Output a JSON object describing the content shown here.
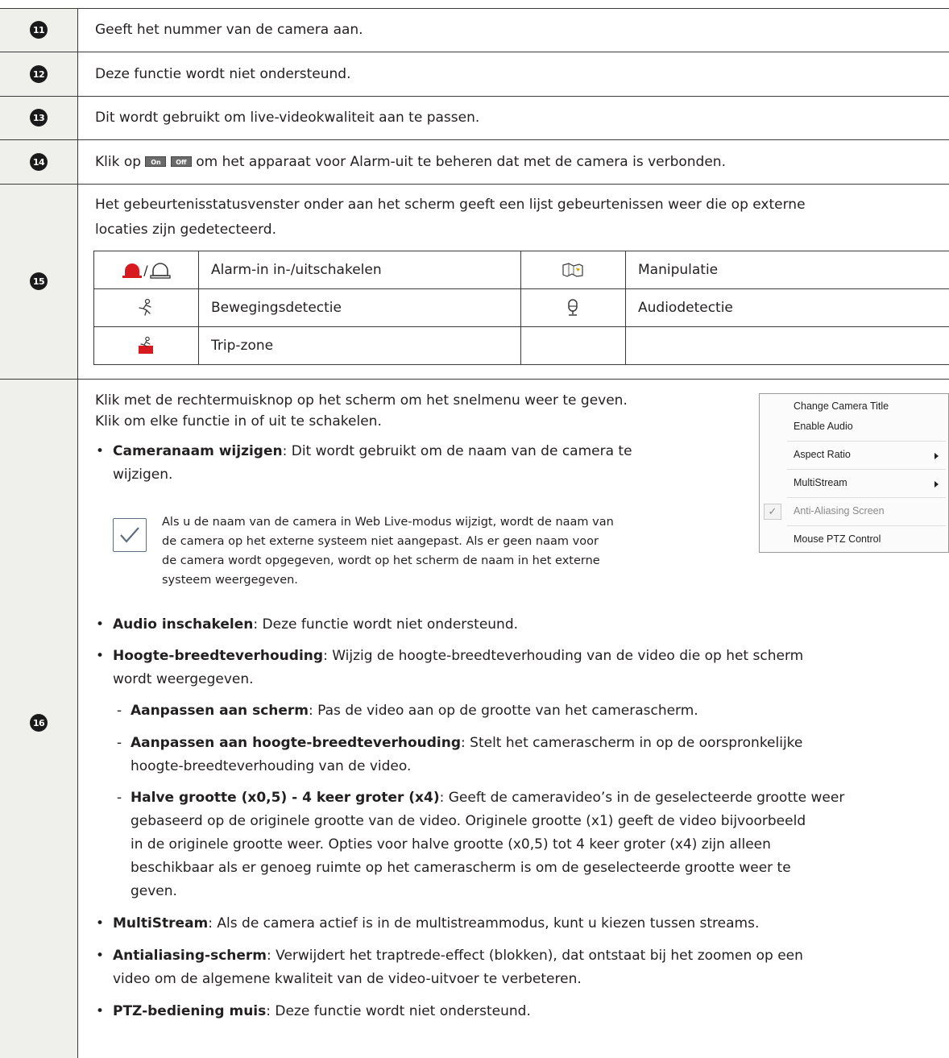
{
  "rows": [
    {
      "num": "11",
      "text": "Geeft het nummer van de camera aan."
    },
    {
      "num": "12",
      "text": "Deze functie wordt niet ondersteund."
    },
    {
      "num": "13",
      "text": "Dit wordt gebruikt om live-videokwaliteit aan te passen."
    },
    {
      "num": "14",
      "text_before": "Klik op",
      "btn_on": "On",
      "btn_off": "Off",
      "text_after": "om het apparaat voor Alarm-uit te beheren dat met de camera is verbonden."
    },
    {
      "num": "15",
      "line1": "Het gebeurtenisstatusvenster onder aan het scherm geeft een lijst gebeurtenissen weer die op externe",
      "line2": "locaties zijn gedetecteerd."
    },
    {
      "num": "16"
    }
  ],
  "events": [
    {
      "icon": "alarm-in-icon",
      "sep": "/",
      "label": "Alarm-in in-/uitschakelen"
    },
    {
      "icon": "tampering-icon",
      "label": "Manipulatie"
    },
    {
      "icon": "motion-detection-icon",
      "label": "Bewegingsdetectie"
    },
    {
      "icon": "audio-detection-icon",
      "label": "Audiodetectie"
    },
    {
      "icon": "trip-zone-icon",
      "label": "Trip-zone"
    }
  ],
  "row16": {
    "intro1": "Klik met de rechtermuisknop op het scherm om het snelmenu weer te geven.",
    "intro2": "Klik om elke functie in of uit te schakelen.",
    "cam_title": "Cameranaam wijzigen",
    "cam_desc1": ": Dit wordt gebruikt om de naam van de camera te",
    "cam_desc2": "wijzigen.",
    "note": [
      "Als u de naam van de camera in Web Live-modus wijzigt, wordt de naam van",
      "de camera op het externe systeem niet aangepast. Als er geen naam voor",
      "de camera wordt opgegeven, wordt op het scherm de naam in het externe",
      "systeem weergegeven."
    ],
    "audio_title": "Audio inschakelen",
    "audio_desc": ": Deze functie wordt niet ondersteund.",
    "aspect_title": "Hoogte-breedteverhouding",
    "aspect_desc1": ": Wijzig de hoogte-breedteverhouding van de video die op het scherm",
    "aspect_desc2": "wordt weergegeven.",
    "fit_title": "Aanpassen aan scherm",
    "fit_desc": ": Pas de video aan op de grootte van het camerascherm.",
    "ratio_title": "Aanpassen aan hoogte-breedteverhouding",
    "ratio_desc1": ": Stelt het camerascherm in op de oorspronkelijke",
    "ratio_desc2": "hoogte-breedteverhouding van de video.",
    "half_title": "Halve grootte (x0,5) - 4 keer groter (x4)",
    "half_desc1": ": Geeft de cameravideo’s in de geselecteerde grootte weer",
    "half_desc2": "gebaseerd op de originele grootte van de video. Originele grootte (x1) geeft de video bijvoorbeeld",
    "half_desc3": "in de originele grootte weer. Opties voor halve grootte (x0,5) tot 4 keer groter (x4) zijn alleen",
    "half_desc4": "beschikbaar als er genoeg ruimte op het camerascherm is om de geselecteerde grootte weer te",
    "half_desc5": "geven.",
    "multi_title": "MultiStream",
    "multi_desc": ": Als de camera actief is in de multistreammodus, kunt u kiezen tussen streams.",
    "anti_title": "Antialiasing-scherm",
    "anti_desc1": ": Verwijdert het traptrede-effect (blokken), dat ontstaat bij het zoomen op een",
    "anti_desc2": "video om de algemene kwaliteit van de video-uitvoer te verbeteren.",
    "ptz_title": "PTZ-bediening muis",
    "ptz_desc": ": Deze functie wordt niet ondersteund."
  },
  "context_menu": {
    "items": [
      "Change Camera Title",
      "Enable Audio",
      "Aspect Ratio",
      "MultiStream",
      "Anti-Aliasing Screen",
      "Mouse PTZ Control"
    ],
    "check": "✓"
  },
  "colors": {
    "grid": "#3a3a3a",
    "column_bg": "#efefec",
    "alarm_red": "#d71920",
    "note_box": "#5d6e80"
  }
}
